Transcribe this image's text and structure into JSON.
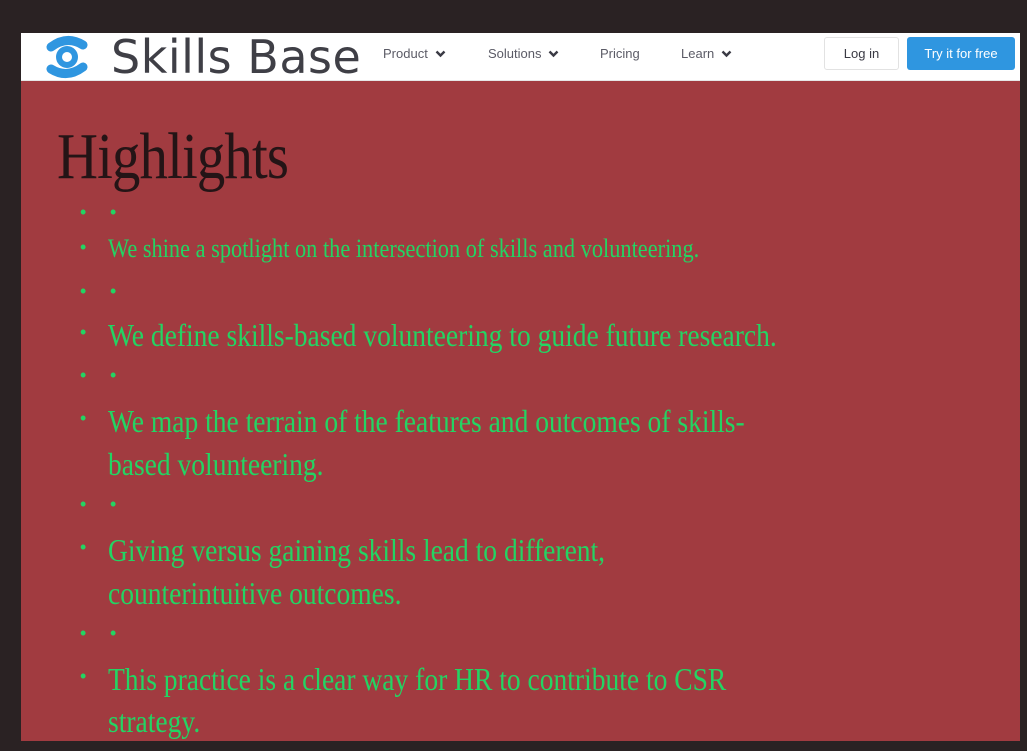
{
  "brand": {
    "name": "Skills Base",
    "logo_icon": "skills-base-logo-icon",
    "colors": {
      "mark_blue": "#2f96e0",
      "text": "#3f3f46"
    }
  },
  "nav": {
    "items": [
      {
        "label": "Product",
        "has_dropdown": true
      },
      {
        "label": "Solutions",
        "has_dropdown": true
      },
      {
        "label": "Pricing",
        "has_dropdown": false
      },
      {
        "label": "Learn",
        "has_dropdown": true
      }
    ],
    "login_label": "Log in",
    "cta_label": "Try it for free"
  },
  "content": {
    "heading": "Highlights",
    "highlights": [
      "We shine a spotlight on the intersection of skills and volunteering.",
      "We define skills-based volunteering to guide future research.",
      "We map the terrain of the features and outcomes of skills-\nbased volunteering.",
      "Giving versus gaining skills lead to different,\ncounterintuitive outcomes.",
      "This practice is a clear way for HR to contribute to CSR\nstrategy."
    ],
    "highlight_lines": [
      [
        "We shine a spotlight on the intersection of skills and volunteering."
      ],
      [
        "We define skills-based volunteering to guide future research."
      ],
      [
        "We map the terrain of the features and outcomes of skills-",
        "based volunteering."
      ],
      [
        "Giving versus gaining skills lead to different,",
        "counterintuitive outcomes."
      ],
      [
        "This practice is a clear way for HR to contribute to CSR",
        "strategy."
      ]
    ],
    "colors": {
      "page_bg": "#a13b40",
      "heading": "#241416",
      "bullet_text": "#23d463",
      "cta": "#2f96e0"
    }
  }
}
